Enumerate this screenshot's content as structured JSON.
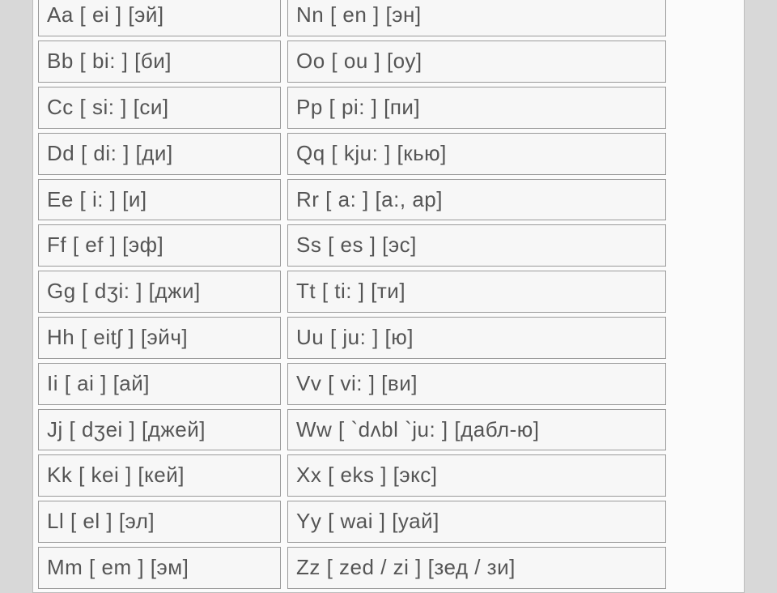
{
  "alphabet": {
    "left": [
      "Aa [ ei ] [эй]",
      "Bb [ bi: ] [би]",
      "Cc [ si: ] [си]",
      "Dd [ di: ] [ди]",
      "Ee [ i: ] [и]",
      "Ff [ ef ] [эф]",
      "Gg [ dʒi: ] [джи]",
      "Hh [ eitʃ ] [эйч]",
      "Ii [ ai ] [ай]",
      "Jj [ dʒei ] [джей]",
      "Kk [ kei ] [кей]",
      "Ll [ el ] [эл]",
      "Mm [ em ] [эм]"
    ],
    "right": [
      "Nn [ en ] [эн]",
      "Oo [ ou ] [оу]",
      "Pp [ pi: ] [пи]",
      "Qq [ kju: ] [кью]",
      "Rr [ a: ] [а:, ар]",
      "Ss [ es ] [эс]",
      "Tt [ ti: ] [ти]",
      "Uu [ ju: ] [ю]",
      "Vv [ vi: ] [ви]",
      "Ww [ `dʌbl `ju: ] [дабл-ю]",
      "Xx [ eks ] [экс]",
      "Yy [ wai ] [уай]",
      "Zz [ zed / zi ] [зед / зи]"
    ]
  }
}
